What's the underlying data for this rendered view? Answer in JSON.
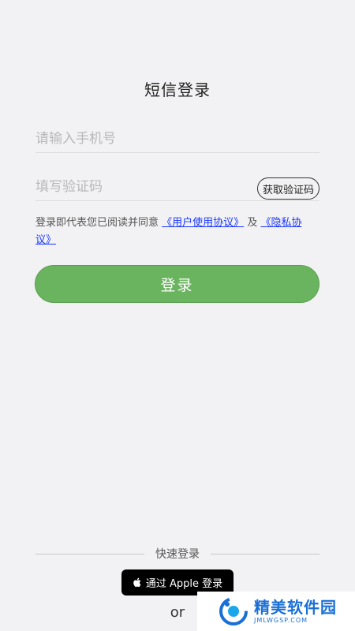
{
  "header": {
    "title": "短信登录"
  },
  "form": {
    "phone_placeholder": "请输入手机号",
    "code_placeholder": "填写验证码",
    "get_code_label": "获取验证码"
  },
  "agreement": {
    "prefix": "登录即代表您已阅读并同意",
    "user_agreement_link": "《用户使用协议》",
    "conjunction": "及",
    "privacy_link": "《隐私协议》"
  },
  "login_button_label": "登录",
  "quick_login": {
    "divider_label": "快速登录",
    "apple_button_label": "通过 Apple 登录",
    "or_label": "or"
  },
  "watermark": {
    "main": "精美软件园",
    "sub": "JMLWGSP.COM"
  },
  "colors": {
    "accent_green": "#6ab35f",
    "link_blue": "#1a36ff"
  }
}
